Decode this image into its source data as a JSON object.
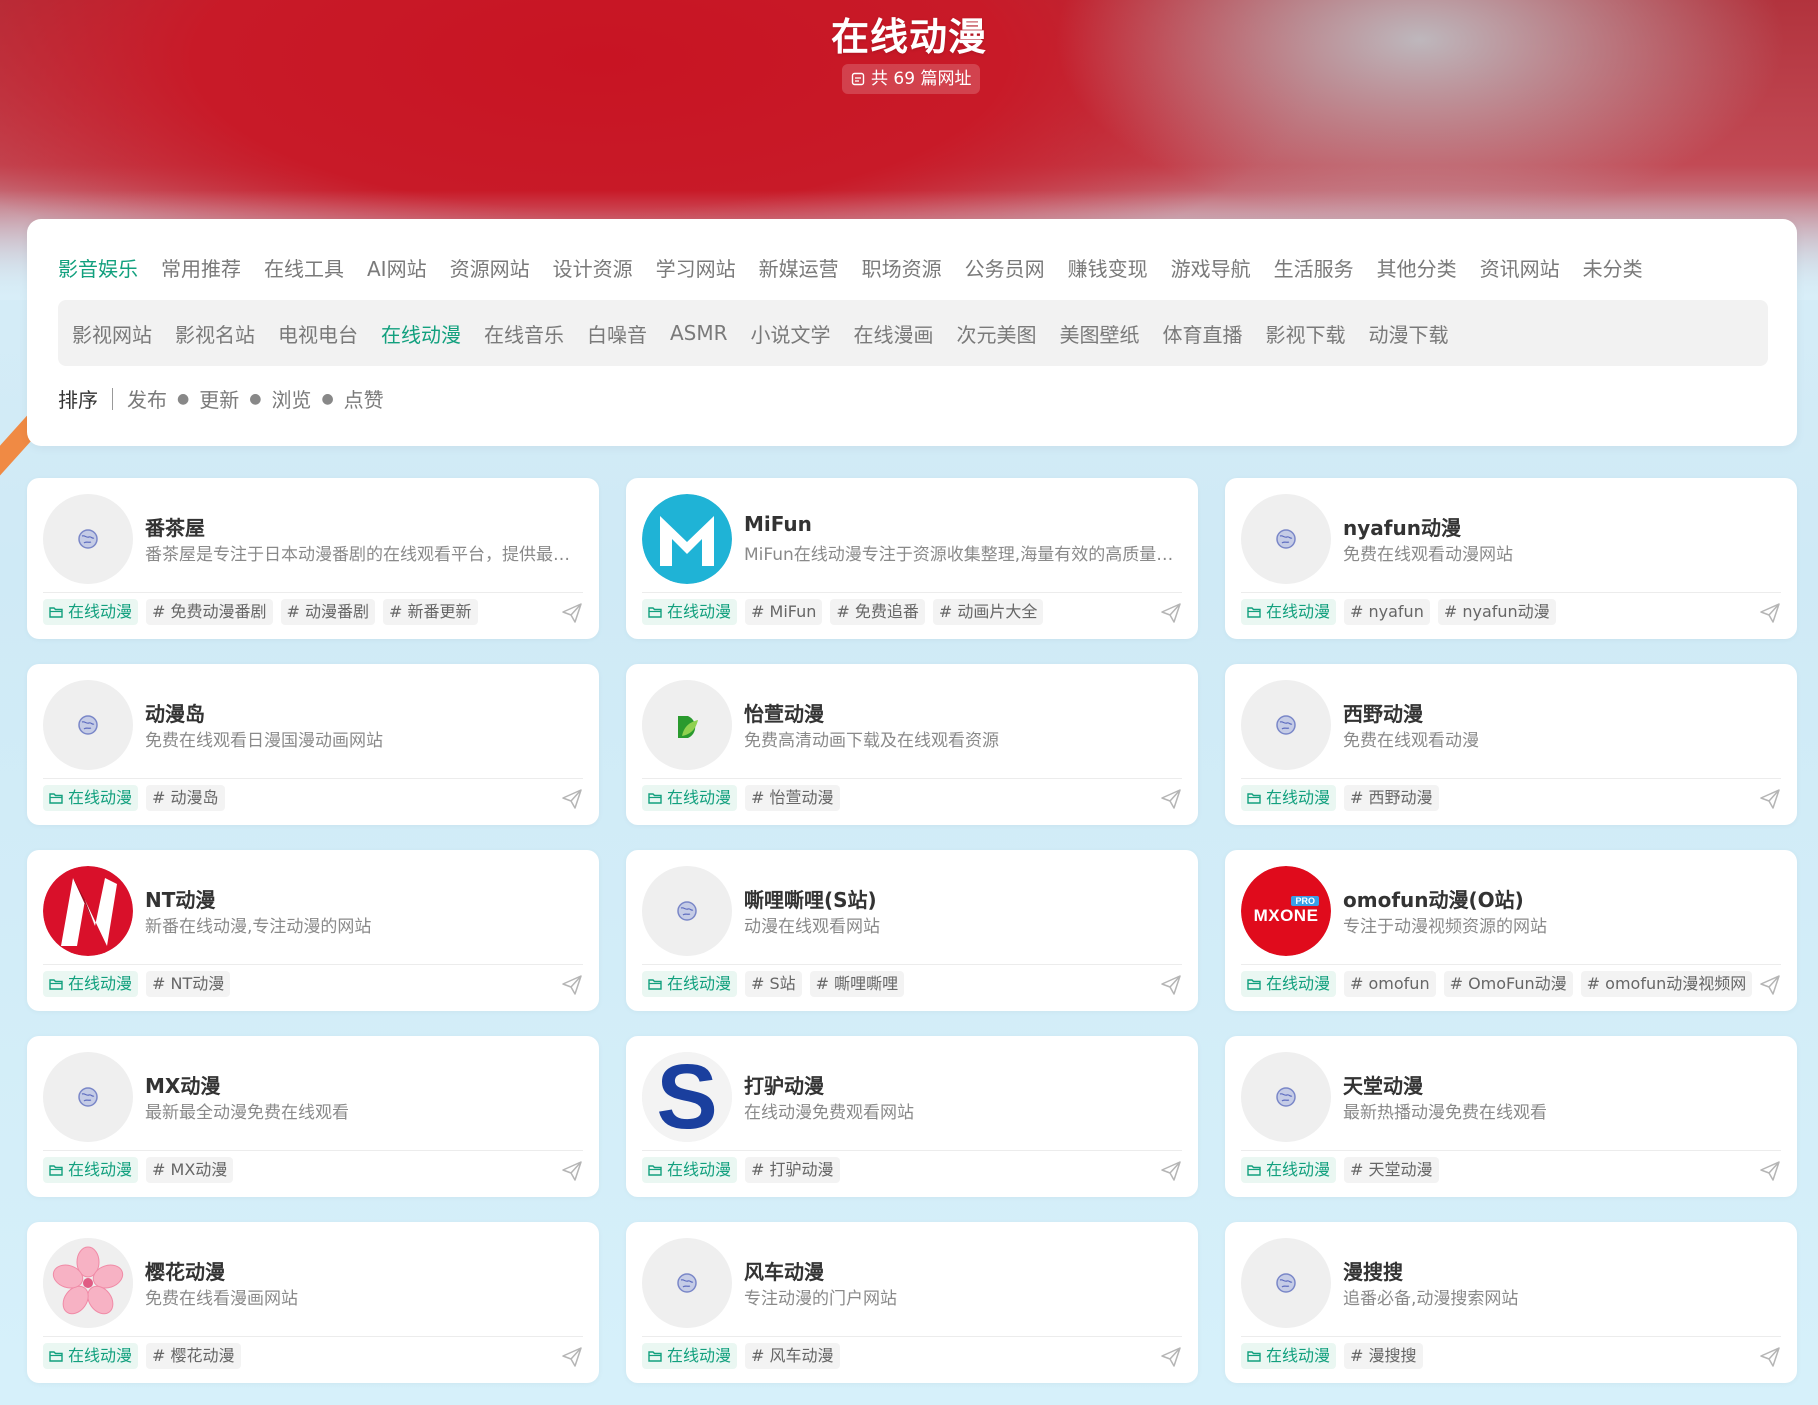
{
  "header": {
    "title": "在线动漫",
    "badge": "共 69 篇网址"
  },
  "categories": [
    "影音娱乐",
    "常用推荐",
    "在线工具",
    "AI网站",
    "资源网站",
    "设计资源",
    "学习网站",
    "新媒运营",
    "职场资源",
    "公务员网",
    "赚钱变现",
    "游戏导航",
    "生活服务",
    "其他分类",
    "资讯网站",
    "未分类"
  ],
  "subcategories": [
    "影视网站",
    "影视名站",
    "电视电台",
    "在线动漫",
    "在线音乐",
    "白噪音",
    "ASMR",
    "小说文学",
    "在线漫画",
    "次元美图",
    "美图壁纸",
    "体育直播",
    "影视下载",
    "动漫下载"
  ],
  "sort": {
    "label": "排序",
    "options": [
      "发布",
      "更新",
      "浏览",
      "点赞"
    ]
  },
  "colors": {
    "accent": "#12a07e",
    "hero_red": "#c81423"
  },
  "cards": [
    {
      "name": "番茶屋",
      "desc": "番茶屋是专注于日本动漫番剧的在线观看平台，提供最新番剧和经典动漫资源",
      "logo": "globe-icon",
      "category": "在线动漫",
      "tags": [
        "# 免费动漫番剧",
        "# 动漫番剧",
        "# 新番更新"
      ]
    },
    {
      "name": "MiFun",
      "desc": "MiFun在线动漫专注于资源收集整理,海量有效的高质量动漫资源",
      "logo": "mifun-logo",
      "category": "在线动漫",
      "tags": [
        "# MiFun",
        "# 免费追番",
        "# 动画片大全"
      ]
    },
    {
      "name": "nyafun动漫",
      "desc": "免费在线观看动漫网站",
      "logo": "globe-icon",
      "category": "在线动漫",
      "tags": [
        "# nyafun",
        "# nyafun动漫"
      ]
    },
    {
      "name": "动漫岛",
      "desc": "免费在线观看日漫国漫动画网站",
      "logo": "globe-icon",
      "category": "在线动漫",
      "tags": [
        "# 动漫岛"
      ]
    },
    {
      "name": "怡萱动漫",
      "desc": "免费高清动画下载及在线观看资源",
      "logo": "yixuan-logo",
      "category": "在线动漫",
      "tags": [
        "# 怡萱动漫"
      ]
    },
    {
      "name": "西野动漫",
      "desc": "免费在线观看动漫",
      "logo": "globe-icon",
      "category": "在线动漫",
      "tags": [
        "# 西野动漫"
      ]
    },
    {
      "name": "NT动漫",
      "desc": "新番在线动漫,专注动漫的网站",
      "logo": "nt-logo",
      "category": "在线动漫",
      "tags": [
        "# NT动漫"
      ]
    },
    {
      "name": "嘶哩嘶哩(S站)",
      "desc": "动漫在线观看网站",
      "logo": "globe-icon",
      "category": "在线动漫",
      "tags": [
        "# S站",
        "# 嘶哩嘶哩"
      ]
    },
    {
      "name": "omofun动漫(O站)",
      "desc": "专注于动漫视频资源的网站",
      "logo": "mxone-logo",
      "logo_text": "MXONE",
      "logo_badge": "PRO",
      "category": "在线动漫",
      "tags": [
        "# omofun",
        "# OmoFun动漫",
        "# omofun动漫视频网"
      ]
    },
    {
      "name": "MX动漫",
      "desc": "最新最全动漫免费在线观看",
      "logo": "globe-icon",
      "category": "在线动漫",
      "tags": [
        "# MX动漫"
      ]
    },
    {
      "name": "打驴动漫",
      "desc": "在线动漫免费观看网站",
      "logo": "s-logo",
      "logo_text": "S",
      "category": "在线动漫",
      "tags": [
        "# 打驴动漫"
      ]
    },
    {
      "name": "天堂动漫",
      "desc": "最新热播动漫免费在线观看",
      "logo": "globe-icon",
      "category": "在线动漫",
      "tags": [
        "# 天堂动漫"
      ]
    },
    {
      "name": "樱花动漫",
      "desc": "免费在线看漫画网站",
      "logo": "sakura-logo",
      "category": "在线动漫",
      "tags": [
        "# 樱花动漫"
      ]
    },
    {
      "name": "风车动漫",
      "desc": "专注动漫的门户网站",
      "logo": "globe-icon",
      "category": "在线动漫",
      "tags": [
        "# 风车动漫"
      ]
    },
    {
      "name": "漫搜搜",
      "desc": "追番必备,动漫搜索网站",
      "logo": "globe-icon",
      "category": "在线动漫",
      "tags": [
        "# 漫搜搜"
      ]
    }
  ]
}
